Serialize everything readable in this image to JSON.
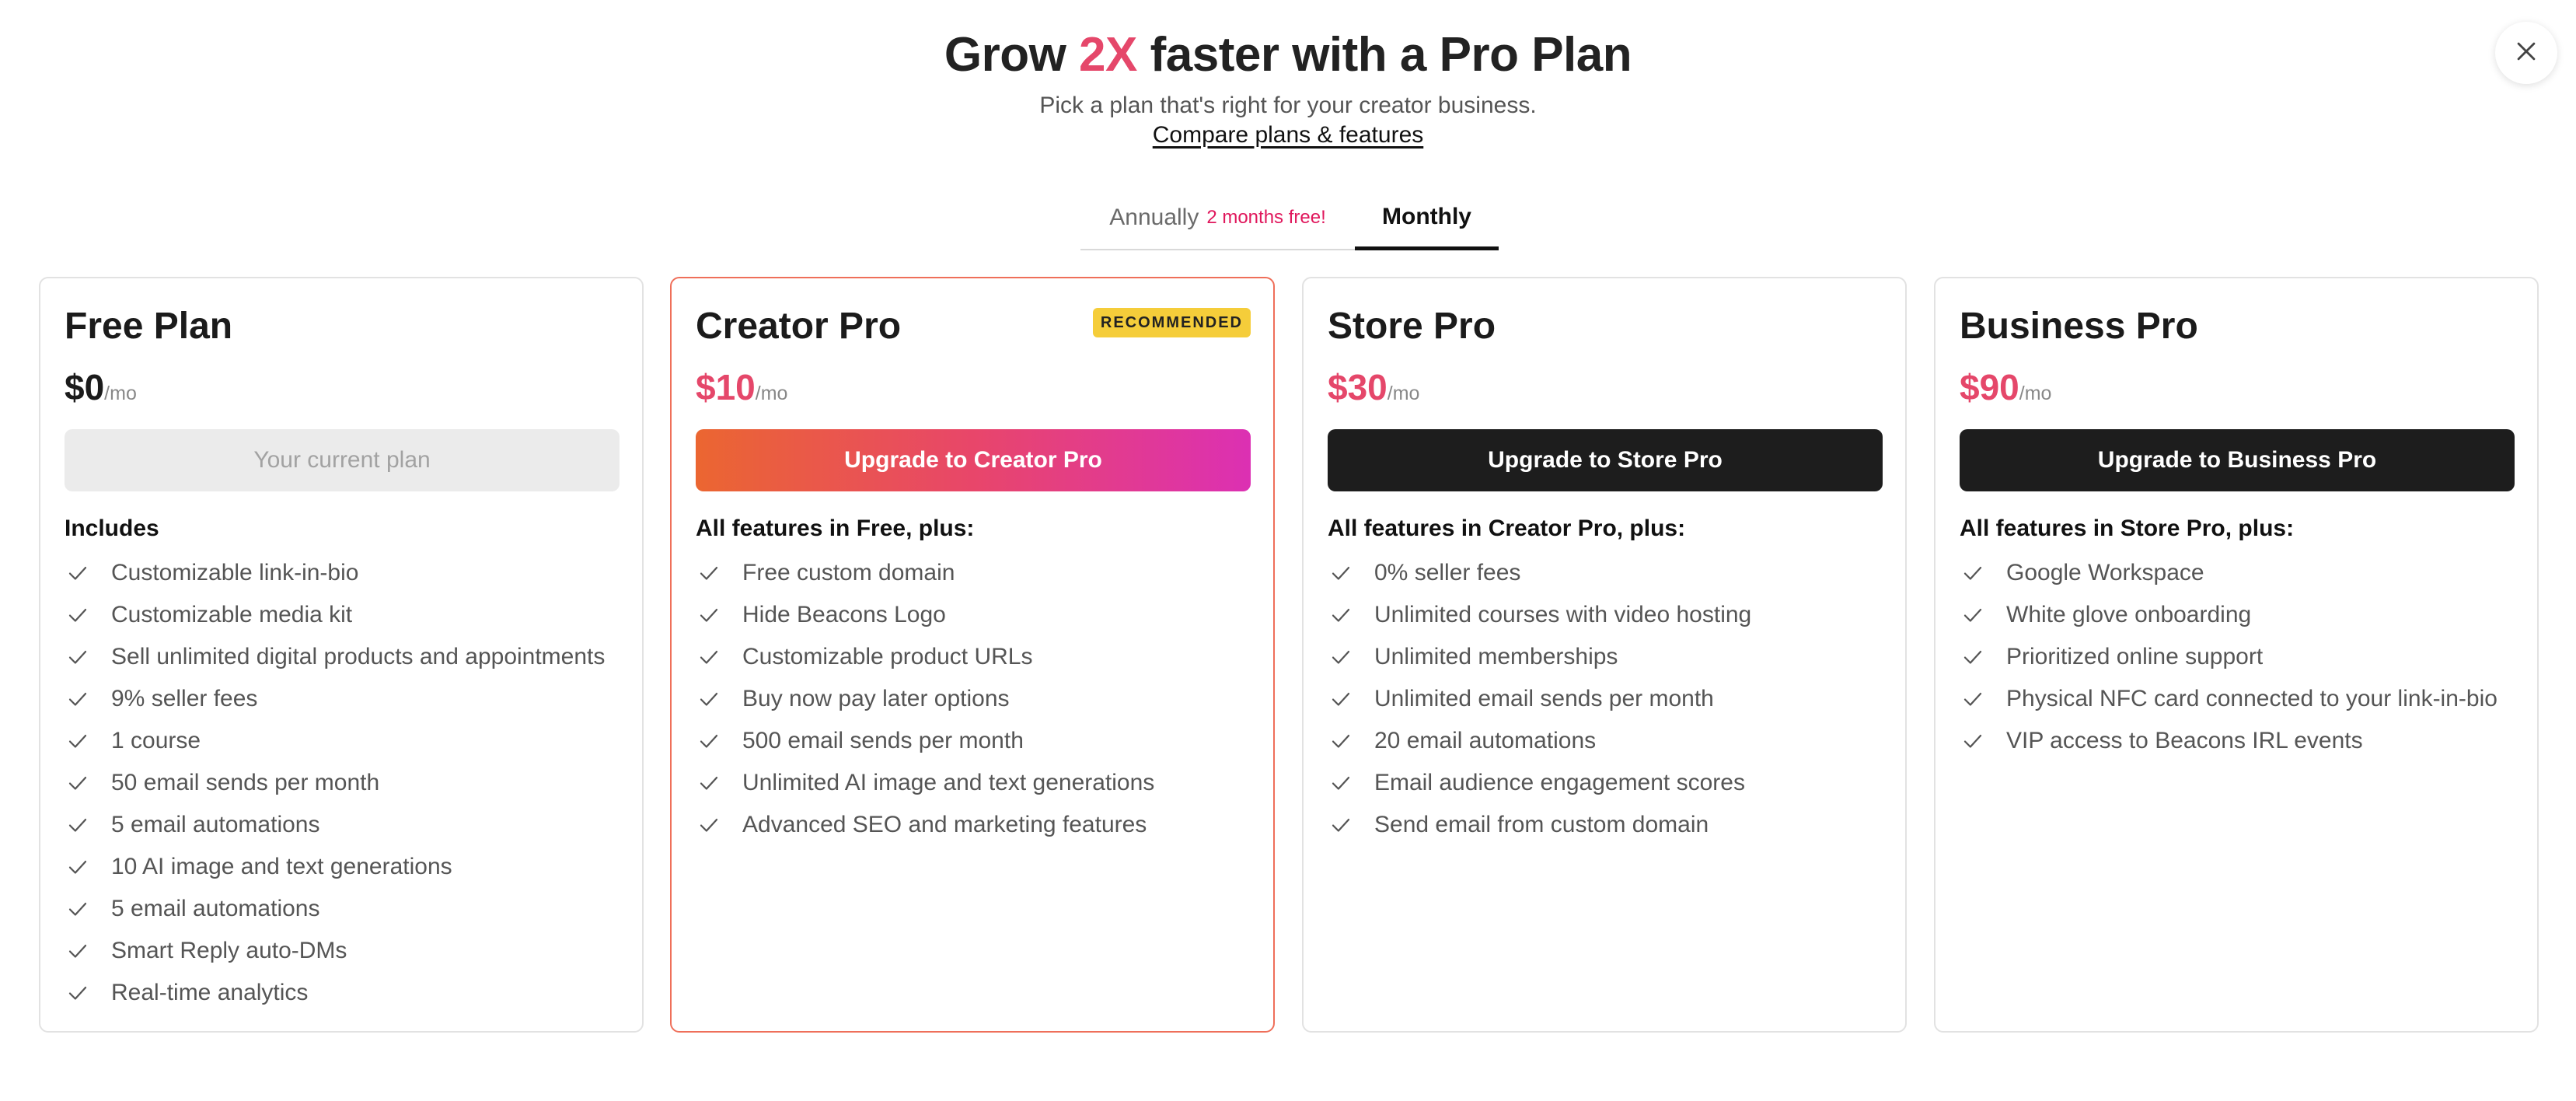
{
  "header": {
    "headline_before": "Grow ",
    "headline_accent": "2X",
    "headline_after": " faster with a Pro Plan",
    "subtitle": "Pick a plan that's right for your creator business.",
    "compare_link": "Compare plans & features"
  },
  "billing_toggle": {
    "annual_label": "Annually",
    "annual_promo": "2 months free!",
    "monthly_label": "Monthly",
    "selected": "Monthly"
  },
  "colors": {
    "accent_pink": "#e5476a",
    "promo_pink": "#e0175c",
    "badge_yellow": "#f5cd3a",
    "dark_button": "#1d1d1d",
    "recommended_border": "#ef6f5a"
  },
  "icons": {
    "close": "close-icon",
    "feature": "check-icon"
  },
  "plans": [
    {
      "name": "Free Plan",
      "price": "$0",
      "period": "/mo",
      "cta": "Your current plan",
      "includes_heading": "Includes",
      "features": [
        "Customizable link-in-bio",
        "Customizable media kit",
        "Sell unlimited digital products and appointments",
        "9% seller fees",
        "1 course",
        "50 email sends per month",
        "5 email automations",
        "10 AI image and text generations",
        "5 email automations",
        "Smart Reply auto-DMs",
        "Real-time analytics"
      ]
    },
    {
      "name": "Creator Pro",
      "badge": "RECOMMENDED",
      "price": "$10",
      "period": "/mo",
      "cta": "Upgrade to Creator Pro",
      "includes_heading": "All features in Free, plus:",
      "features": [
        "Free custom domain",
        "Hide Beacons Logo",
        "Customizable product URLs",
        "Buy now pay later options",
        "500 email sends per month",
        "Unlimited AI image and text generations",
        "Advanced SEO and marketing features"
      ]
    },
    {
      "name": "Store Pro",
      "price": "$30",
      "period": "/mo",
      "cta": "Upgrade to Store Pro",
      "includes_heading": "All features in Creator Pro, plus:",
      "features": [
        "0% seller fees",
        "Unlimited courses with video hosting",
        "Unlimited memberships",
        "Unlimited email sends per month",
        "20 email automations",
        "Email audience engagement scores",
        "Send email from custom domain"
      ]
    },
    {
      "name": "Business Pro",
      "price": "$90",
      "period": "/mo",
      "cta": "Upgrade to Business Pro",
      "includes_heading": "All features in Store Pro, plus:",
      "features": [
        "Google Workspace",
        "White glove onboarding",
        "Prioritized online support",
        "Physical NFC card connected to your link-in-bio",
        "VIP access to Beacons IRL events"
      ]
    }
  ]
}
